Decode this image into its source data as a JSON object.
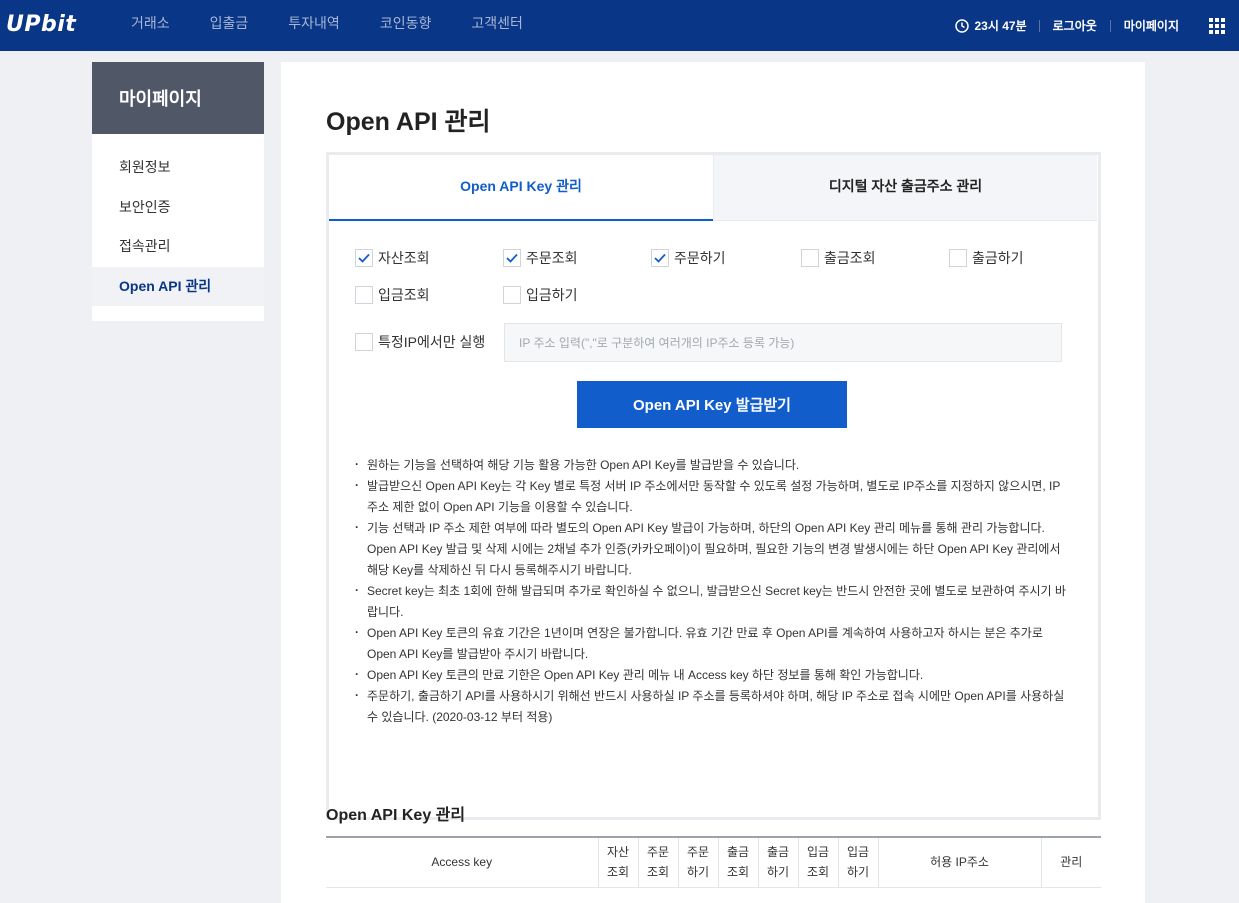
{
  "header": {
    "logo": "UPbit",
    "nav": [
      "거래소",
      "입출금",
      "투자내역",
      "코인동향",
      "고객센터"
    ],
    "clock": "23시 47분",
    "logout": "로그아웃",
    "mypage": "마이페이지",
    "brand_color": "#093687"
  },
  "sidebar": {
    "title": "마이페이지",
    "items": [
      {
        "label": "회원정보"
      },
      {
        "label": "보안인증"
      },
      {
        "label": "접속관리"
      },
      {
        "label": "Open API 관리",
        "active": true
      }
    ]
  },
  "main": {
    "title": "Open API 관리",
    "tabs": [
      {
        "label": "Open API Key 관리",
        "active": true
      },
      {
        "label": "디지털 자산 출금주소 관리",
        "active": false
      }
    ],
    "permissions": [
      {
        "label": "자산조회",
        "checked": true
      },
      {
        "label": "주문조회",
        "checked": true
      },
      {
        "label": "주문하기",
        "checked": true
      },
      {
        "label": "출금조회",
        "checked": false
      },
      {
        "label": "출금하기",
        "checked": false
      },
      {
        "label": "입금조회",
        "checked": false
      },
      {
        "label": "입금하기",
        "checked": false
      }
    ],
    "ip_only": {
      "label": "특정IP에서만 실행",
      "checked": false
    },
    "ip_placeholder": "IP 주소 입력(\",\"로 구분하여 여러개의 IP주소 등록 가능)",
    "issue_button": "Open API Key 발급받기",
    "notes": [
      "원하는 기능을 선택하여 해당 기능 활용 가능한 Open API Key를 발급받을 수 있습니다.",
      "발급받으신 Open API Key는 각 Key 별로 특정 서버 IP 주소에서만 동작할 수 있도록 설정 가능하며, 별도로 IP주소를 지정하지 않으시면, IP 주소 제한 없이 Open API 기능을 이용할 수 있습니다.",
      "기능 선택과 IP 주소 제한 여부에 따라 별도의 Open API Key 발급이 가능하며, 하단의 Open API Key 관리 메뉴를 통해 관리 가능합니다. Open API Key 발급 및 삭제 시에는 2채널 추가 인증(카카오페이)이 필요하며, 필요한 기능의 변경 발생시에는 하단 Open API Key 관리에서 해당 Key를 삭제하신 뒤 다시 등록해주시기 바랍니다.",
      "Secret key는 최초 1회에 한해 발급되며 추가로 확인하실 수 없으니, 발급받으신 Secret key는 반드시 안전한 곳에 별도로 보관하여 주시기 바랍니다.",
      "Open API Key 토큰의 유효 기간은 1년이며 연장은 불가합니다. 유효 기간 만료 후 Open API를 계속하여 사용하고자 하시는 분은 추가로 Open API Key를 발급받아 주시기 바랍니다.",
      "Open API Key 토큰의 만료 기한은 Open API Key 관리 메뉴 내 Access key 하단 정보를 통해 확인 가능합니다.",
      "주문하기, 출금하기 API를 사용하시기 위해선 반드시 사용하실 IP 주소를 등록하셔야 하며, 해당 IP 주소로 접속 시에만 Open API를 사용하실 수 있습니다. (2020-03-12 부터 적용)"
    ],
    "key_section_title": "Open API Key 관리",
    "table_headers": [
      [
        "Access key"
      ],
      [
        "자산",
        "조회"
      ],
      [
        "주문",
        "조회"
      ],
      [
        "주문",
        "하기"
      ],
      [
        "출금",
        "조회"
      ],
      [
        "출금",
        "하기"
      ],
      [
        "입금",
        "조회"
      ],
      [
        "입금",
        "하기"
      ],
      [
        "허용 IP주소"
      ],
      [
        "관리"
      ]
    ]
  }
}
